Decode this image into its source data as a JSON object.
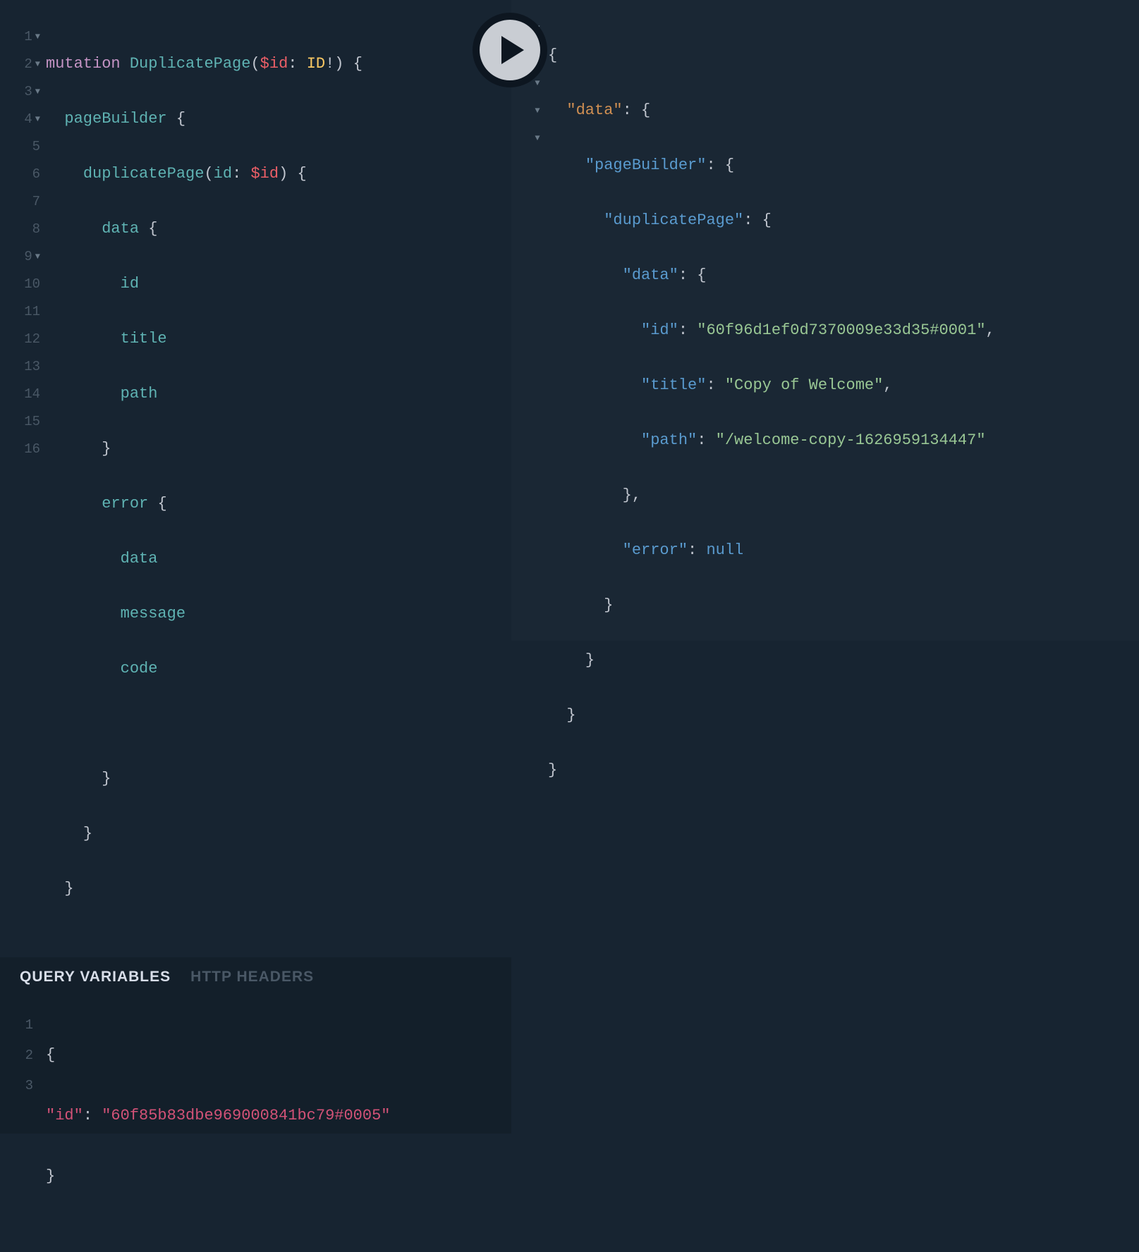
{
  "query": {
    "l1": {
      "keyword": "mutation",
      "name": "DuplicatePage",
      "varName": "$id",
      "varType": "ID",
      "bang": "!"
    },
    "l2": {
      "field": "pageBuilder"
    },
    "l3": {
      "field": "duplicatePage",
      "argName": "id",
      "varRef": "$id"
    },
    "l4": {
      "field": "data"
    },
    "l5": {
      "field": "id"
    },
    "l6": {
      "field": "title"
    },
    "l7": {
      "field": "path"
    },
    "l9": {
      "field": "error"
    },
    "l10": {
      "field": "data"
    },
    "l11": {
      "field": "message"
    },
    "l12": {
      "field": "code"
    },
    "lineNumbers": [
      "1",
      "2",
      "3",
      "4",
      "5",
      "6",
      "7",
      "8",
      "9",
      "10",
      "11",
      "12",
      "13",
      "14",
      "15",
      "16"
    ],
    "foldLines": [
      true,
      true,
      true,
      true,
      false,
      false,
      false,
      false,
      true,
      false,
      false,
      false,
      false,
      false,
      false,
      false
    ]
  },
  "variablesPanel": {
    "tabActive": "QUERY VARIABLES",
    "tabInactive": "HTTP HEADERS",
    "lineNumbers": [
      "1",
      "2",
      "3"
    ],
    "key": "\"id\"",
    "value": "\"60f85b83dbe969000841bc79#0005\""
  },
  "result": {
    "foldLines": [
      true,
      true,
      true,
      true,
      true,
      false,
      false,
      false,
      false,
      false,
      false,
      false,
      false,
      false
    ],
    "k_data": "\"data\"",
    "k_pageBuilder": "\"pageBuilder\"",
    "k_duplicatePage": "\"duplicatePage\"",
    "k_id": "\"id\"",
    "k_title": "\"title\"",
    "k_path": "\"path\"",
    "k_error": "\"error\"",
    "v_id": "\"60f96d1ef0d7370009e33d35#0001\"",
    "v_title": "\"Copy of Welcome\"",
    "v_path": "\"/welcome-copy-1626959134447\"",
    "v_null": "null"
  }
}
